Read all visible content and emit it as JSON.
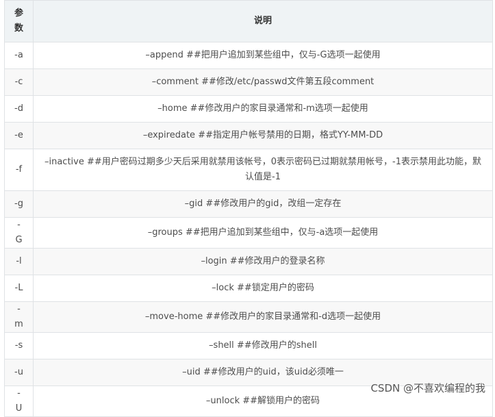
{
  "table": {
    "headers": {
      "param_line1": "参",
      "param_line2": "数",
      "desc": "说明"
    },
    "rows": [
      {
        "param": "-a",
        "desc": "–append ##把用户追加到某些组中，仅与-G选项一起使用"
      },
      {
        "param": "-c",
        "desc": "–comment ##修改/etc/passwd文件第五段comment"
      },
      {
        "param": "-d",
        "desc": "–home ##修改用户的家目录通常和-m选项一起使用"
      },
      {
        "param": "-e",
        "desc": "–expiredate ##指定用户帐号禁用的日期，格式YY-MM-DD"
      },
      {
        "param": "-f",
        "desc": "–inactive ##用户密码过期多少天后采用就禁用该帐号，0表示密码已过期就禁用帐号，-1表示禁用此功能，默认值是-1"
      },
      {
        "param": "-g",
        "desc": "–gid ##修改用户的gid，改组一定存在"
      },
      {
        "param": "-G",
        "desc": "–groups ##把用户追加到某些组中，仅与-a选项一起使用"
      },
      {
        "param": "-l",
        "desc": "–login ##修改用户的登录名称"
      },
      {
        "param": "-L",
        "desc": "–lock ##锁定用户的密码"
      },
      {
        "param": "-m",
        "desc": "–move-home ##修改用户的家目录通常和-d选项一起使用"
      },
      {
        "param": "-s",
        "desc": "–shell ##修改用户的shell"
      },
      {
        "param": "-u",
        "desc": "–uid ##修改用户的uid，该uid必须唯一"
      },
      {
        "param": "-U",
        "desc": "–unlock ##解锁用户的密码"
      }
    ]
  },
  "watermark": "CSDN @不喜欢编程的我",
  "colors": {
    "header_bg": "#eff3f5",
    "stripe_bg": "#f8f8f8",
    "border": "#dfe2e5",
    "text": "#4d4d4d"
  }
}
